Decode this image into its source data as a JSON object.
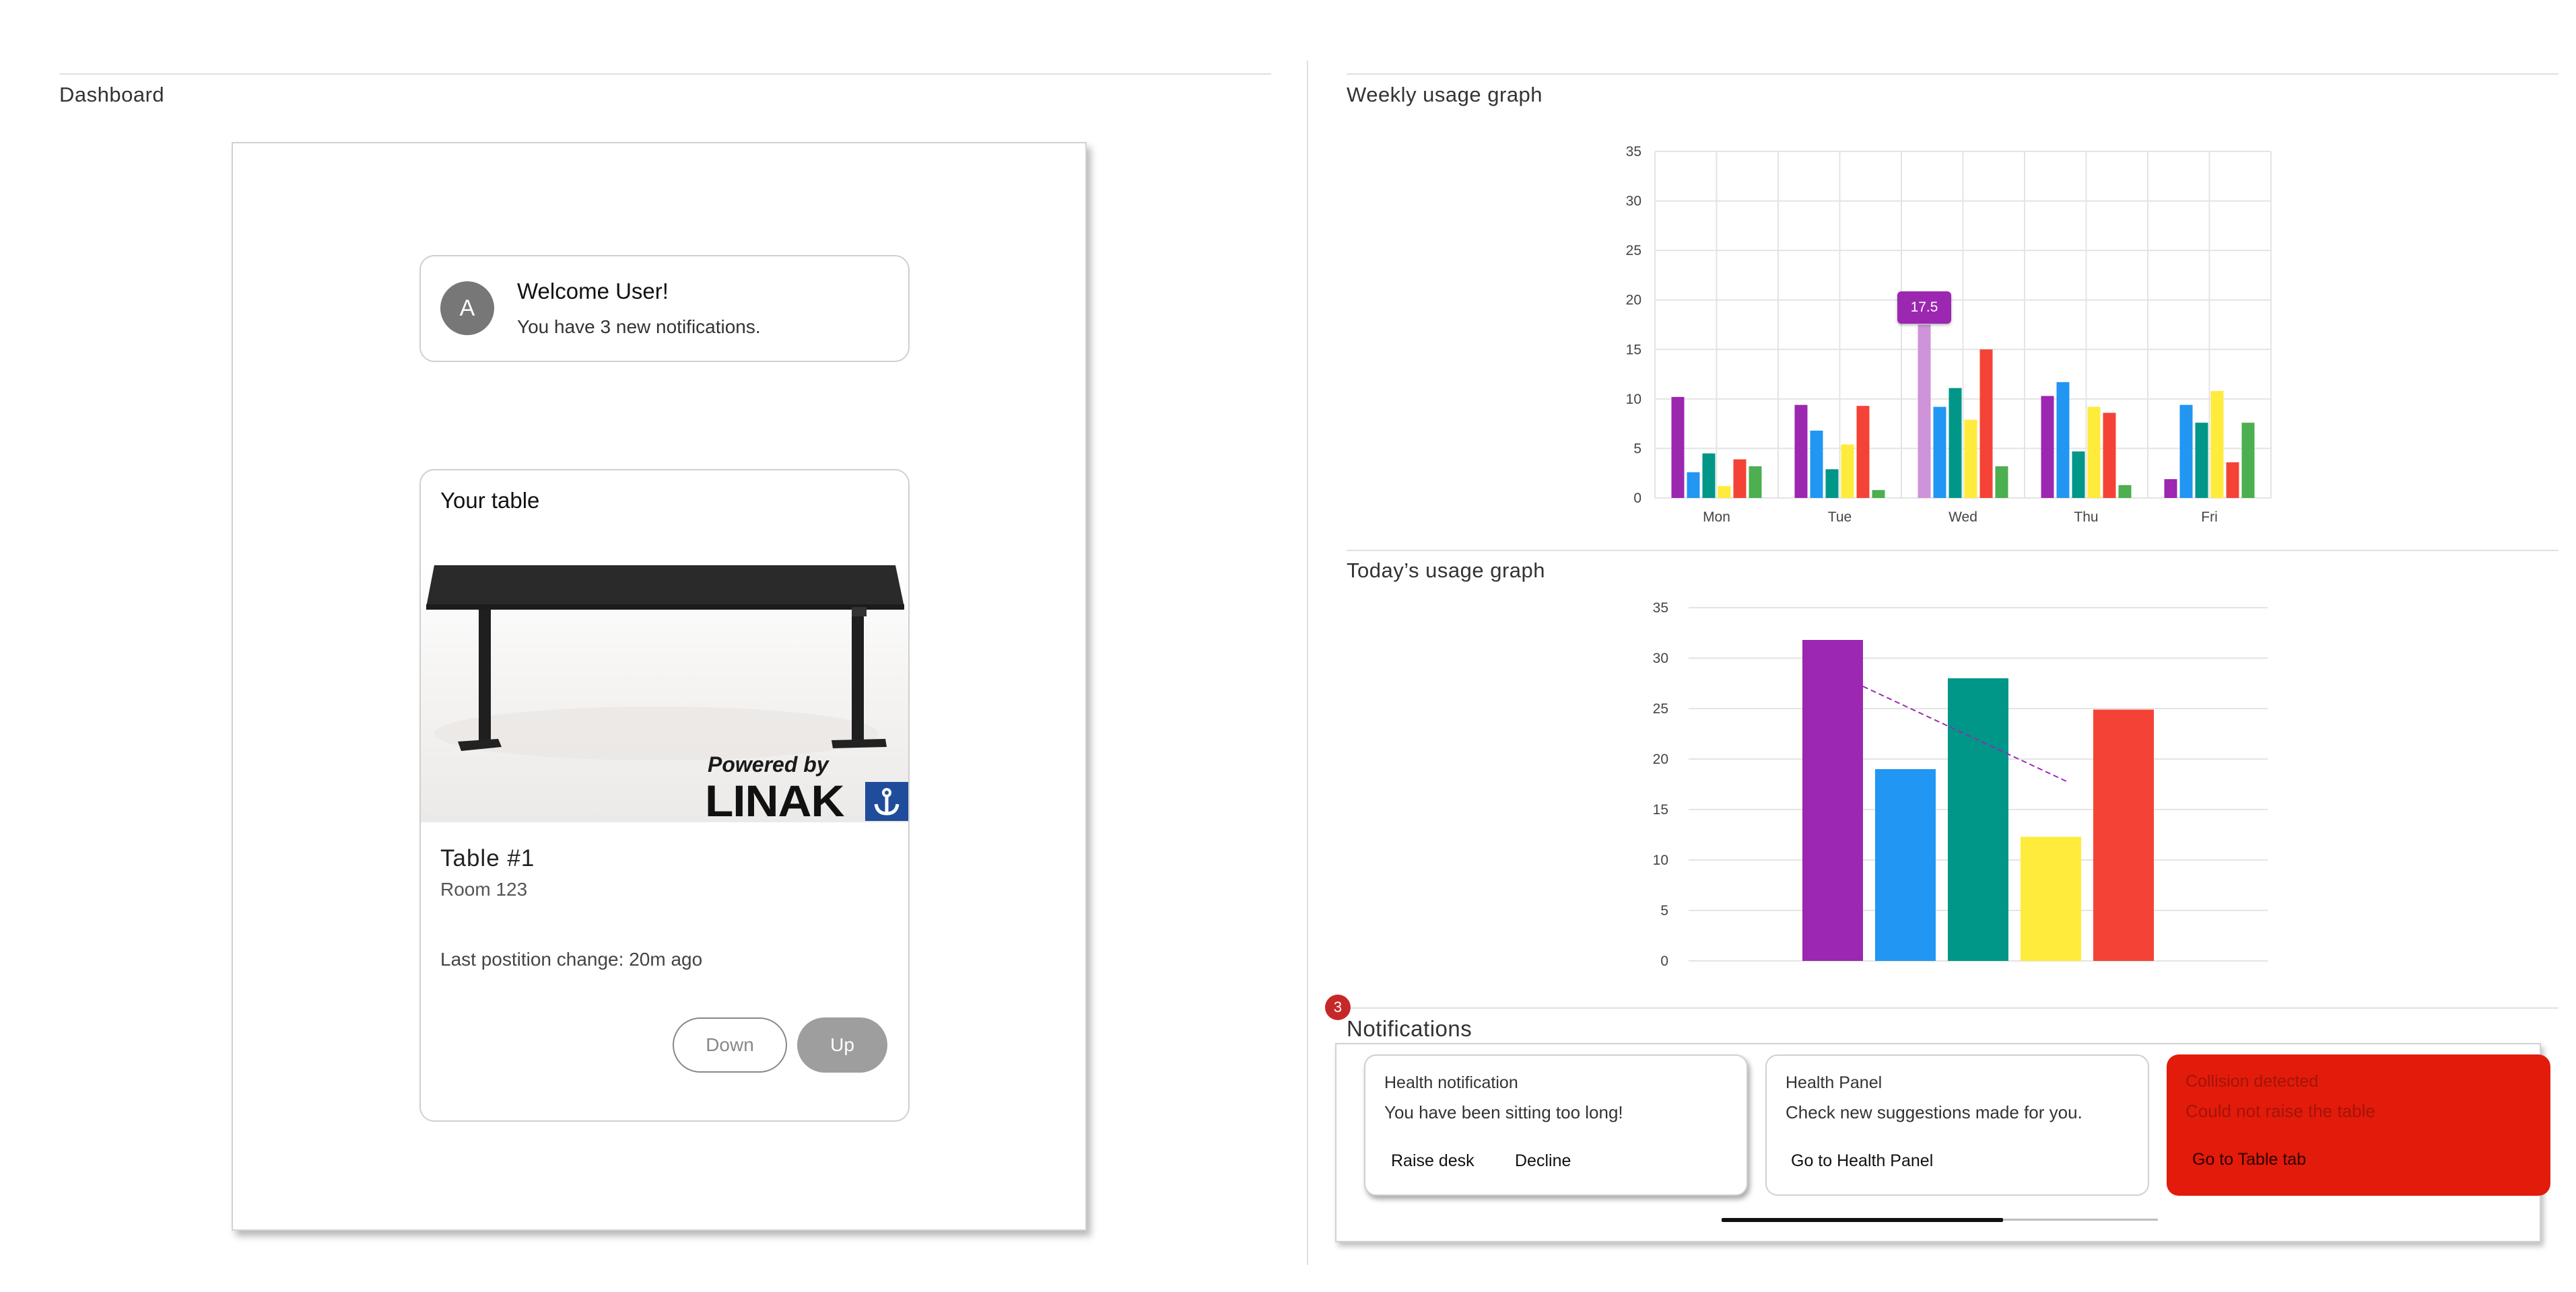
{
  "dashboard": {
    "title": "Dashboard",
    "welcome": {
      "avatar_letter": "A",
      "title": "Welcome User!",
      "subtitle": "You have 3 new notifications."
    },
    "table_card": {
      "title": "Your table",
      "name": "Table #1",
      "room": "Room 123",
      "last_change": "Last postition change: 20m ago",
      "down_label": "Down",
      "up_label": "Up",
      "brand_tagline": "Powered by",
      "brand_name": "LINAK"
    }
  },
  "weekly_graph": {
    "title": "Weekly usage graph",
    "tooltip": "17.5"
  },
  "today_graph": {
    "title": "Today’s usage graph"
  },
  "notifications": {
    "title": "Notifications",
    "count": "3",
    "cards": [
      {
        "title": "Health notification",
        "message": "You have been sitting too long!",
        "actions": [
          "Raise desk",
          "Decline"
        ]
      },
      {
        "title": "Health Panel",
        "message": "Check new suggestions made for you.",
        "actions": [
          "Go to Health Panel"
        ]
      },
      {
        "title": "Collision detected",
        "message": "Could not raise the table",
        "actions": [
          "Go to Table tab"
        ]
      }
    ]
  },
  "colors": {
    "purple": "#9c27b0",
    "blue": "#2196f3",
    "teal": "#009688",
    "yellow": "#ffeb3b",
    "red": "#f44336",
    "green": "#4caf50",
    "alert_red": "#e31b0b"
  },
  "chart_data": [
    {
      "type": "bar",
      "title": "Weekly usage graph",
      "categories": [
        "Mon",
        "Tue",
        "Wed",
        "Thu",
        "Fri"
      ],
      "series": [
        {
          "values": [
            10.2,
            9.4,
            17.5,
            10.3,
            1.9
          ],
          "color": "#9c27b0"
        },
        {
          "values": [
            2.6,
            6.8,
            9.2,
            11.7,
            9.4
          ],
          "color": "#2196f3"
        },
        {
          "values": [
            4.5,
            2.9,
            11.1,
            4.7,
            7.6
          ],
          "color": "#009688"
        },
        {
          "values": [
            1.2,
            5.4,
            7.9,
            9.2,
            10.8
          ],
          "color": "#ffeb3b"
        },
        {
          "values": [
            3.9,
            9.3,
            15.0,
            8.6,
            3.6
          ],
          "color": "#f44336"
        },
        {
          "values": [
            3.2,
            0.8,
            3.2,
            1.3,
            7.6
          ],
          "color": "#4caf50"
        }
      ],
      "ylim": [
        0,
        35
      ],
      "yticks": [
        0,
        5,
        10,
        15,
        20,
        25,
        30,
        35
      ],
      "grid": true,
      "highlight": {
        "category": "Wed",
        "series": 0,
        "label": "17.5"
      }
    },
    {
      "type": "bar",
      "title": "Today’s usage graph",
      "categories": [
        "",
        "",
        "",
        "",
        ""
      ],
      "values": [
        31.8,
        19.0,
        28.0,
        12.3,
        24.9
      ],
      "colors": [
        "#9c27b0",
        "#2196f3",
        "#009688",
        "#ffeb3b",
        "#f44336"
      ],
      "trendline": [
        27.2,
        17.8
      ],
      "ylim": [
        0,
        35
      ],
      "yticks": [
        0,
        5,
        10,
        15,
        20,
        25,
        30,
        35
      ],
      "grid": true
    }
  ]
}
